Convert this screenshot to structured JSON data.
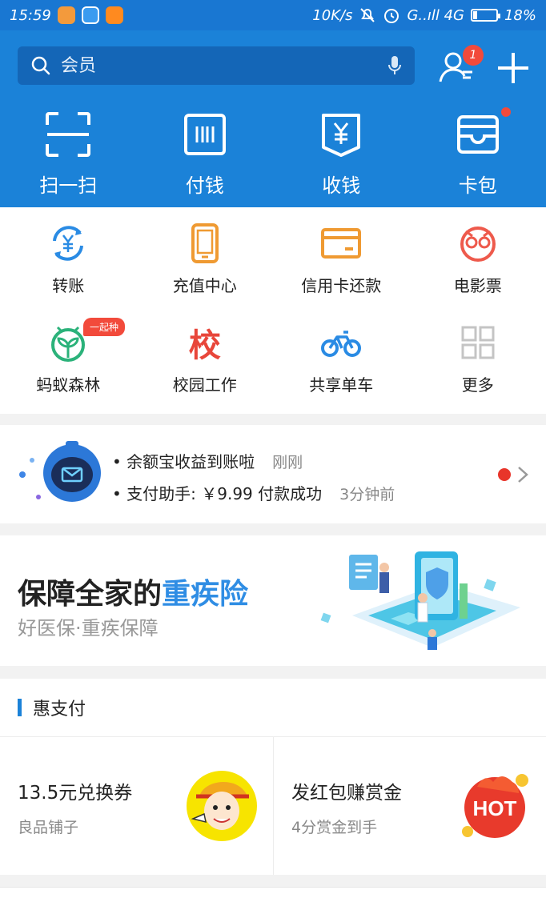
{
  "status_bar": {
    "time": "15:59",
    "speed": "10K/s",
    "network": "G..ıll 4G",
    "battery": "18%",
    "battery_level": 0.18
  },
  "search": {
    "placeholder": "会员",
    "contacts_badge": "1"
  },
  "quick_actions": [
    {
      "label": "扫一扫",
      "icon": "scan-icon"
    },
    {
      "label": "付钱",
      "icon": "pay-code-icon"
    },
    {
      "label": "收钱",
      "icon": "receive-money-icon"
    },
    {
      "label": "卡包",
      "icon": "card-wallet-icon"
    }
  ],
  "grid": [
    {
      "label": "转账",
      "icon": "transfer-icon"
    },
    {
      "label": "充值中心",
      "icon": "phone-recharge-icon"
    },
    {
      "label": "信用卡还款",
      "icon": "credit-card-icon"
    },
    {
      "label": "电影票",
      "icon": "movie-ticket-icon"
    },
    {
      "label": "蚂蚁森林",
      "icon": "ant-forest-icon",
      "tag": "一起种"
    },
    {
      "label": "校园工作",
      "icon": "campus-icon",
      "glyph": "校"
    },
    {
      "label": "共享单车",
      "icon": "bike-icon"
    },
    {
      "label": "更多",
      "icon": "more-grid-icon"
    }
  ],
  "notifications": [
    {
      "text": "• 余额宝收益到账啦",
      "time": "刚刚"
    },
    {
      "text": "• 支付助手: ￥9.99 付款成功",
      "time": "3分钟前"
    }
  ],
  "promo": {
    "title_main": "保障全家的",
    "title_highlight": "重疾险",
    "subtitle": "好医保·重疾保障"
  },
  "hui_zhifu": {
    "heading": "惠支付",
    "cards": [
      {
        "title": "13.5元兑换券",
        "desc": "良品铺子",
        "image": "liangpin-mascot"
      },
      {
        "title": "发红包赚赏金",
        "desc": "4分赏金到手",
        "image": "hot-badge",
        "image_text": "HOT"
      }
    ]
  },
  "colors": {
    "brand_blue": "#1b82d8",
    "search_blue": "#1466b7",
    "badge_red": "#f24a3b",
    "highlight_blue": "#2f8de4"
  }
}
